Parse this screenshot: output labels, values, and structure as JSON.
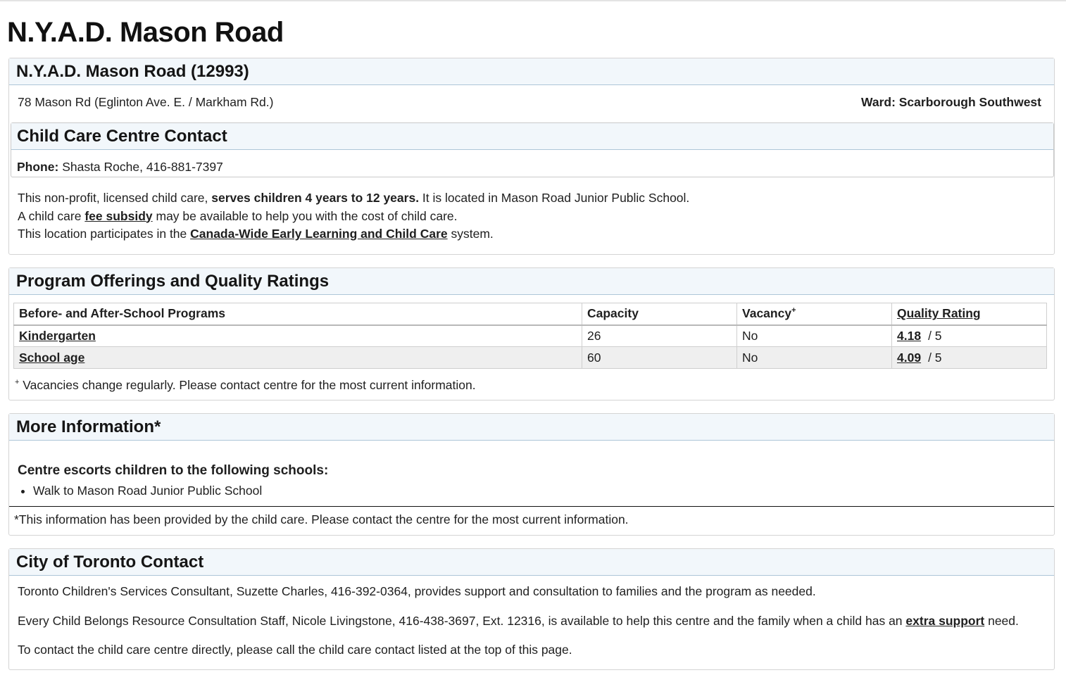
{
  "page": {
    "title": "N.Y.A.D. Mason Road"
  },
  "centre": {
    "heading": "N.Y.A.D. Mason Road (12993)",
    "address": "78 Mason Rd  (Eglinton Ave. E. / Markham Rd.)",
    "ward": "Ward: Scarborough Southwest"
  },
  "contact": {
    "heading": "Child Care Centre Contact",
    "phone_label": "Phone:",
    "phone_value": "Shasta Roche,  416-881-7397"
  },
  "description": {
    "line1_a": "This non-profit, licensed child care, ",
    "line1_b": "serves children 4 years to 12 years.",
    "line1_c": " It is located in Mason Road Junior Public School.",
    "line2_a": "A child care ",
    "line2_link": "fee subsidy",
    "line2_b": " may be available to help you with the cost of child care.",
    "line3_a": "This location participates in the ",
    "line3_link": "Canada-Wide Early Learning and Child Care",
    "line3_b": " system."
  },
  "programs": {
    "heading": "Program Offerings and Quality Ratings",
    "columns": [
      "Before- and After-School Programs",
      "Capacity",
      "Vacancy",
      "Quality Rating"
    ],
    "vacancy_sup": "+",
    "rows": [
      {
        "program": "Kindergarten",
        "capacity": "26",
        "vacancy": "No",
        "rating": "4.18",
        "out_of": "/ 5"
      },
      {
        "program": "School age",
        "capacity": "60",
        "vacancy": "No",
        "rating": "4.09",
        "out_of": "/ 5"
      }
    ],
    "footnote_sup": "+",
    "footnote": " Vacancies change regularly. Please contact centre for the most current information."
  },
  "more_info": {
    "heading": "More Information*",
    "escort_title": "Centre escorts children to the following schools:",
    "escort_items": [
      "Walk to Mason Road Junior Public School"
    ],
    "note": "*This information has been provided by the child care. Please contact the centre for the most current information."
  },
  "city": {
    "heading": "City of Toronto Contact",
    "p1": "Toronto Children's Services Consultant, Suzette Charles, 416-392-0364, provides support and consultation to families and the program as needed.",
    "p2_a": "Every Child Belongs Resource Consultation Staff, Nicole Livingstone, 416-438-3697, Ext. 12316, is available to help this centre and the family when a child has an ",
    "p2_link": "extra support",
    "p2_b": " need.",
    "p3": "To contact the child care centre directly, please call the child care contact listed at the top of this page."
  }
}
